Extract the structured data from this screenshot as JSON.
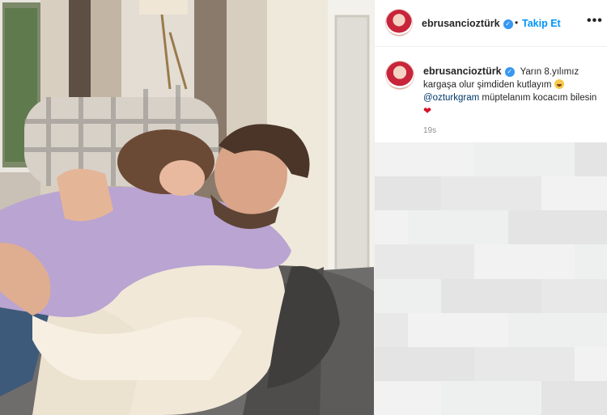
{
  "post": {
    "username": "ebrusancioztürk",
    "verified": true,
    "follow_label": "Takip Et",
    "separator": "•",
    "more_label": "•••",
    "caption": {
      "username": "ebrusancioztürk",
      "text_part1": "Yarın 8.yılımız kargaşa olur şimdiden kutlayım",
      "mention": "@ozturkgram",
      "text_part2": "müptelanım kocacım bilesin",
      "emoji_1": "laughing-emoji",
      "emoji_2": "heart-emoji"
    },
    "time_ago": "19s"
  },
  "colors": {
    "link_blue": "#0095f6",
    "verified_blue": "#3897f0",
    "mention": "#00376b",
    "text": "#262626",
    "muted": "#8e8e8e",
    "heart": "#d3132a"
  },
  "icons": [
    "verified-badge-icon",
    "more-options-icon",
    "laughing-emoji-icon",
    "heart-emoji-icon"
  ]
}
